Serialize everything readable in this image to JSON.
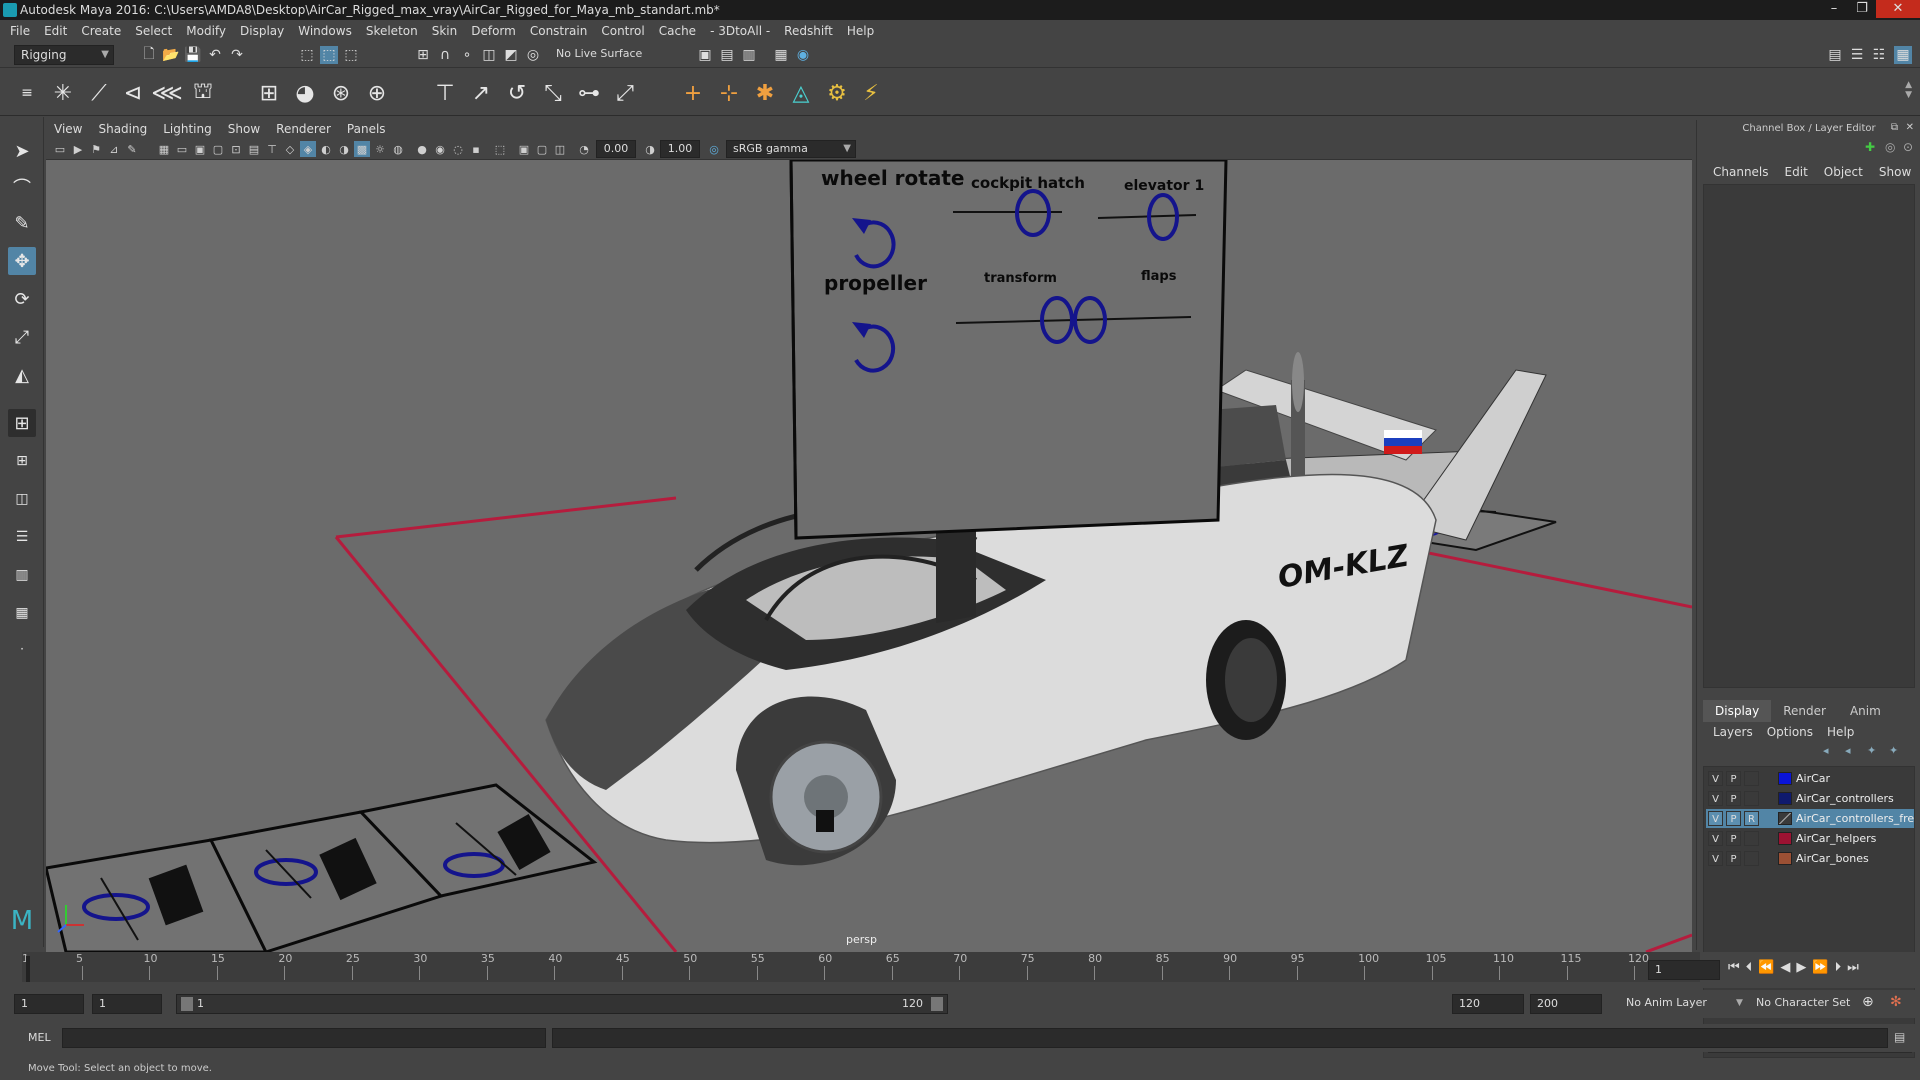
{
  "window": {
    "title": "Autodesk Maya 2016: C:\\Users\\AMDA8\\Desktop\\AirCar_Rigged_max_vray\\AirCar_Rigged_for_Maya_mb_standart.mb*",
    "minimize": "–",
    "maximize": "❐",
    "close": "✕"
  },
  "menubar": [
    "File",
    "Edit",
    "Create",
    "Select",
    "Modify",
    "Display",
    "Windows",
    "Skeleton",
    "Skin",
    "Deform",
    "Constrain",
    "Control",
    "Cache",
    "- 3DtoAll -",
    "Redshift",
    "Help"
  ],
  "statusline": {
    "menuset": "Rigging",
    "live_surface": "No Live Surface"
  },
  "panel": {
    "menu": [
      "View",
      "Shading",
      "Lighting",
      "Show",
      "Renderer",
      "Panels"
    ],
    "exposure": "0.00",
    "gamma": "1.00",
    "colorspace": "sRGB gamma",
    "camera_label": "persp"
  },
  "viewport": {
    "controls_board": {
      "wheel_rotate": "wheel rotate",
      "cockpit_hatch": "cockpit hatch",
      "elevator": "elevator 1",
      "propeller": "propeller",
      "transform": "transform",
      "flaps": "flaps"
    },
    "registration": "OM-KLZ"
  },
  "channelbox": {
    "header": "Channel Box / Layer Editor",
    "menu": [
      "Channels",
      "Edit",
      "Object",
      "Show"
    ],
    "layer_tabs": [
      "Display",
      "Render",
      "Anim"
    ],
    "layer_menu": [
      "Layers",
      "Options",
      "Help"
    ],
    "layers": [
      {
        "v": "V",
        "p": "P",
        "r": "",
        "name": "AirCar",
        "color": "#0a14d8",
        "selected": false
      },
      {
        "v": "V",
        "p": "P",
        "r": "",
        "name": "AirCar_controllers",
        "color": "#0f1a6e",
        "selected": false
      },
      {
        "v": "V",
        "p": "P",
        "r": "R",
        "name": "AirCar_controllers_freeze",
        "color": "#2a2a2a",
        "selected": true
      },
      {
        "v": "V",
        "p": "P",
        "r": "",
        "name": "AirCar_helpers",
        "color": "#9c1232",
        "selected": false
      },
      {
        "v": "V",
        "p": "P",
        "r": "",
        "name": "AirCar_bones",
        "color": "#9b5034",
        "selected": false
      }
    ]
  },
  "timeline": {
    "ticks": [
      "1",
      "5",
      "10",
      "15",
      "20",
      "25",
      "30",
      "35",
      "40",
      "45",
      "50",
      "55",
      "60",
      "65",
      "70",
      "75",
      "80",
      "85",
      "90",
      "95",
      "100",
      "105",
      "110",
      "115",
      "120"
    ],
    "current_frame": "1",
    "range_start": "1",
    "range_inner_start": "1",
    "range_slider_start": "1",
    "range_slider_end": "120",
    "range_end": "120",
    "anim_end": "200",
    "anim_layer": "No Anim Layer",
    "character_set": "No Character Set"
  },
  "commandline": {
    "label": "MEL"
  },
  "helpline": "Move Tool: Select an object to move."
}
